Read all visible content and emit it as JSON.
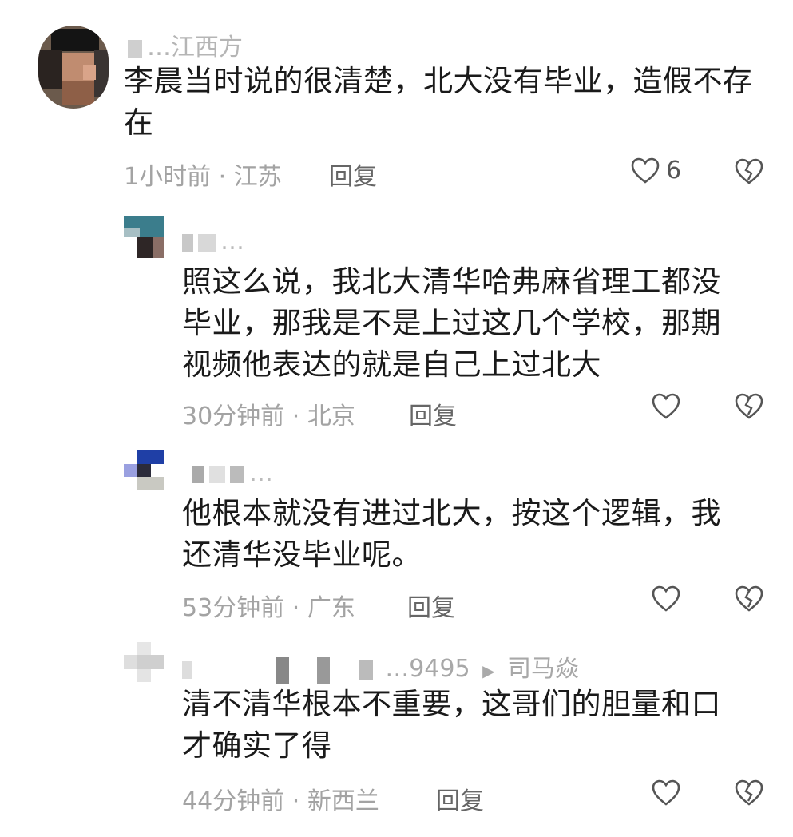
{
  "comments": [
    {
      "user": "…江西方",
      "text": "李晨当时说的很清楚，北大没有毕业，造假不存在",
      "time": "1小时前",
      "location": "江苏",
      "reply_label": "回复",
      "like_count": "6"
    },
    {
      "user": "…",
      "text": "照这么说，我北大清华哈弗麻省理工都没毕业，那我是不是上过这几个学校，那期视频他表达的就是自己上过北大",
      "time": "30分钟前",
      "location": "北京",
      "reply_label": "回复",
      "like_count": ""
    },
    {
      "user": "…",
      "text": "他根本就没有进过北大，按这个逻辑，我还清华没毕业呢。",
      "time": "53分钟前",
      "location": "广东",
      "reply_label": "回复",
      "like_count": ""
    },
    {
      "user": "…9495",
      "reply_to": "司马焱",
      "text": "清不清华根本不重要，这哥们的胆量和口才确实了得",
      "time": "44分钟前",
      "location": "新西兰",
      "reply_label": "回复",
      "like_count": ""
    }
  ],
  "meta_separator": "·",
  "reply_arrow": "▶",
  "icons": {
    "like": "heart-outline-icon",
    "dislike": "broken-heart-icon"
  },
  "colors": {
    "meta": "#a3a3a3",
    "text": "#1a1a1a",
    "icon": "#555555"
  }
}
